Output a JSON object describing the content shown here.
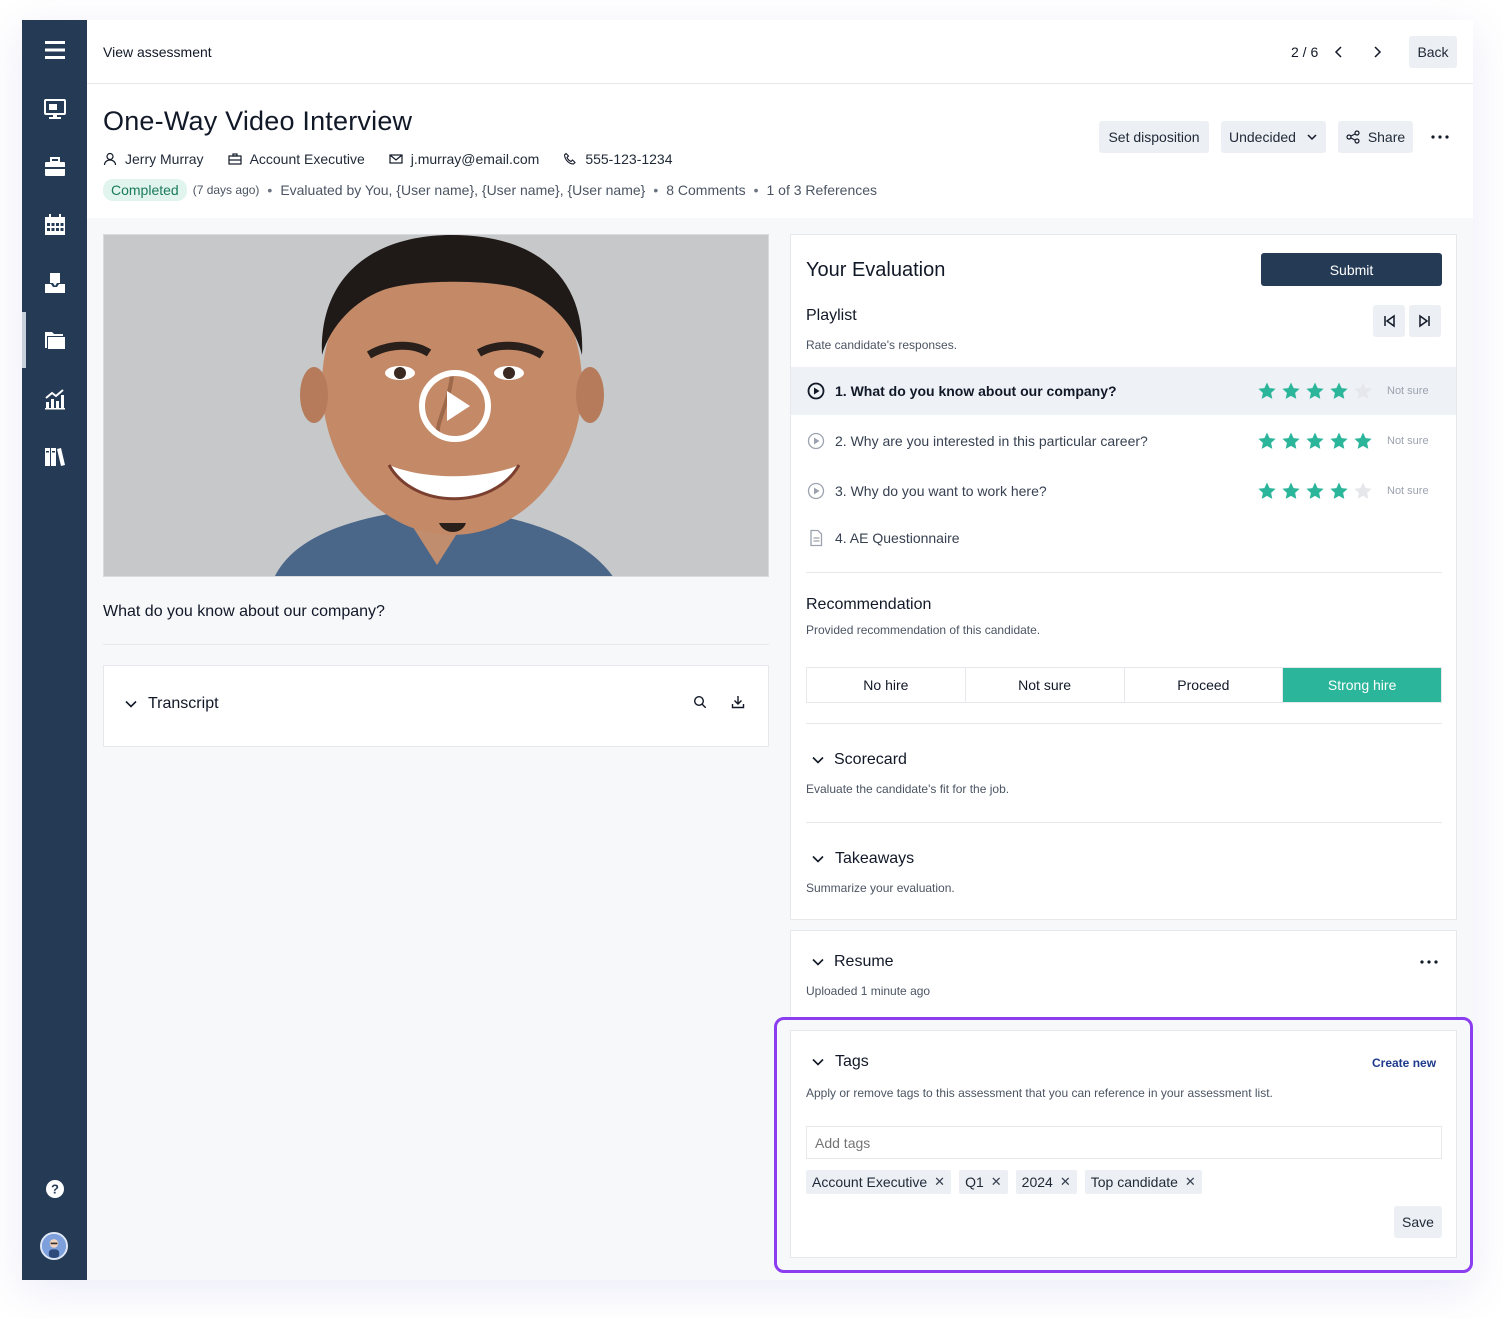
{
  "topbar": {
    "breadcrumb": "View assessment",
    "pager": "2 / 6",
    "back_label": "Back"
  },
  "header": {
    "title": "One-Way Video Interview",
    "candidate_name": "Jerry Murray",
    "job_title": "Account Executive",
    "email": "j.murray@email.com",
    "phone": "555-123-1234",
    "status": "Completed",
    "status_age": "(7 days ago)",
    "evaluated_by": "Evaluated by You, {User name},  {User name},  {User name}",
    "comments": "8 Comments",
    "references": "1 of 3 References",
    "set_disposition_label": "Set disposition",
    "disposition_value": "Undecided",
    "share_label": "Share"
  },
  "video": {
    "question": "What do you know about our company?"
  },
  "transcript": {
    "label": "Transcript"
  },
  "evaluation": {
    "title": "Your Evaluation",
    "submit_label": "Submit",
    "playlist_title": "Playlist",
    "playlist_sub": "Rate candidate's responses.",
    "items": [
      {
        "label": "1.  What do you know about our company?",
        "rating": 4,
        "not_sure": "Not sure",
        "active": true,
        "type": "video"
      },
      {
        "label": "2.  Why are you interested in this particular career?",
        "rating": 5,
        "not_sure": "Not sure",
        "active": false,
        "type": "video"
      },
      {
        "label": "3.  Why do you want to work here?",
        "rating": 4,
        "not_sure": "Not sure",
        "active": false,
        "type": "video"
      },
      {
        "label": "4.  AE Questionnaire",
        "rating": null,
        "not_sure": "",
        "active": false,
        "type": "document"
      }
    ],
    "recommendation_title": "Recommendation",
    "recommendation_sub": "Provided recommendation of this candidate.",
    "recommendation_options": [
      "No hire",
      "Not sure",
      "Proceed",
      "Strong hire"
    ],
    "recommendation_selected": "Strong hire",
    "scorecard_title": "Scorecard",
    "scorecard_sub": "Evaluate the candidate's fit for the job.",
    "takeaways_title": "Takeaways",
    "takeaways_sub": "Summarize your evaluation."
  },
  "resume": {
    "title": "Resume",
    "sub": "Uploaded 1 minute ago"
  },
  "tags": {
    "title": "Tags",
    "create_new_label": "Create new",
    "sub": "Apply or remove tags to this assessment that you can reference in your assessment list.",
    "input_placeholder": "Add tags",
    "items": [
      "Account Executive",
      "Q1",
      "2024",
      "Top candidate"
    ],
    "save_label": "Save"
  },
  "colors": {
    "sidebar": "#243a55",
    "accent_green": "#2bb59a",
    "submit": "#243a55",
    "highlight": "#8b3df0",
    "link": "#1e3a8a"
  }
}
